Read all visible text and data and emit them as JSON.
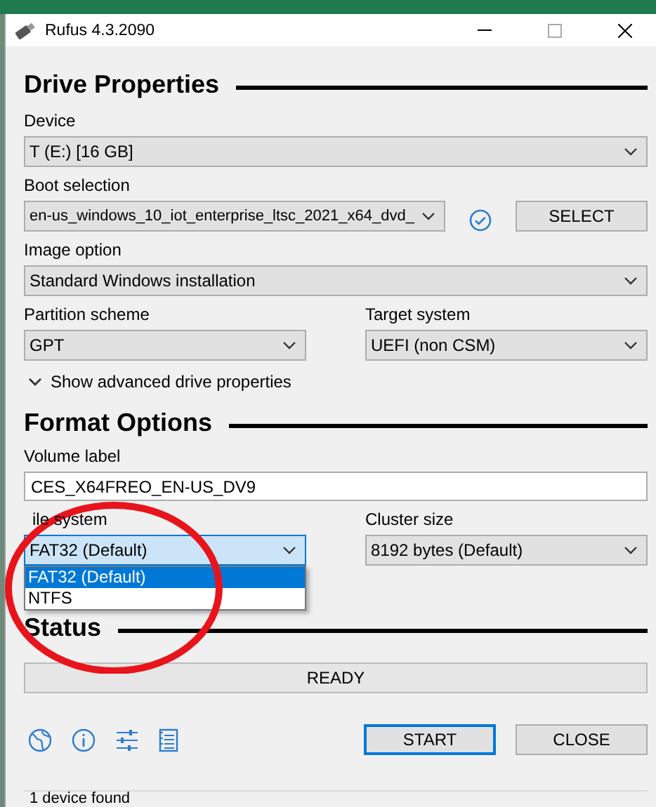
{
  "window": {
    "title": "Rufus 4.3.2090"
  },
  "drive_properties": {
    "heading": "Drive Properties",
    "device": {
      "label": "Device",
      "value": "T (E:) [16 GB]"
    },
    "boot_selection": {
      "label": "Boot selection",
      "value": "en-us_windows_10_iot_enterprise_ltsc_2021_x64_dvd_",
      "verified": true,
      "button": "SELECT"
    },
    "image_option": {
      "label": "Image option",
      "value": "Standard Windows installation"
    },
    "partition_scheme": {
      "label": "Partition scheme",
      "value": "GPT"
    },
    "target_system": {
      "label": "Target system",
      "value": "UEFI (non CSM)"
    },
    "advanced": {
      "label": "Show advanced drive properties",
      "expanded": false
    }
  },
  "format_options": {
    "heading": "Format Options",
    "volume_label": {
      "label": "Volume label",
      "value": "CES_X64FREO_EN-US_DV9"
    },
    "file_system": {
      "label": "ile system",
      "value": "FAT32 (Default)",
      "expanded": true,
      "options": [
        {
          "label": "FAT32 (Default)",
          "selected": true
        },
        {
          "label": "NTFS",
          "selected": false
        }
      ]
    },
    "cluster_size": {
      "label": "Cluster size",
      "value": "8192 bytes (Default)"
    }
  },
  "status": {
    "heading": "Status",
    "progress": {
      "text": "READY",
      "level": 0
    }
  },
  "buttons": [
    {
      "label": "START",
      "default": true
    },
    {
      "label": "CLOSE",
      "default": false
    }
  ],
  "status_bar": {
    "text": "1 device found"
  },
  "annotation": {
    "kind": "circle",
    "color": "#e8141c"
  }
}
